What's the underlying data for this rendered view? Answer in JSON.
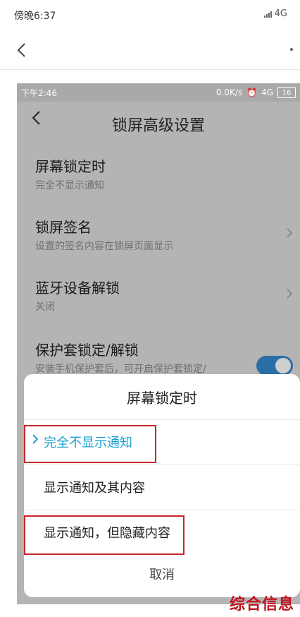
{
  "outer_status": {
    "time": "傍晚6:37",
    "network": "4G"
  },
  "inner_status": {
    "time": "下午2:46",
    "speed": "0.0K/s",
    "network": "4G",
    "battery": "16"
  },
  "inner_header": {
    "title": "锁屏高级设置"
  },
  "settings": [
    {
      "title": "屏幕锁定时",
      "subtitle": "完全不显示通知"
    },
    {
      "title": "锁屏签名",
      "subtitle": "设置的签名内容在锁屏页面显示"
    },
    {
      "title": "蓝牙设备解锁",
      "subtitle": "关闭"
    },
    {
      "title": "保护套锁定/解锁",
      "subtitle": "安装手机保护套后，可开启保护套锁定/"
    }
  ],
  "sheet": {
    "title": "屏幕锁定时",
    "options": [
      {
        "label": "完全不显示通知",
        "selected": true
      },
      {
        "label": "显示通知及其内容",
        "selected": false
      },
      {
        "label": "显示通知，但隐藏内容",
        "selected": false
      }
    ],
    "cancel": "取消"
  },
  "watermark": "综合信息",
  "colors": {
    "accent": "#1aa0d2",
    "annotation_red": "#c62828",
    "toggle_on": "#2b6ea6"
  },
  "icons": {
    "back": "chevron-left-icon",
    "more": "more-dot-icon",
    "chevron": "chevron-right-icon",
    "selected": "chevron-right-icon"
  }
}
